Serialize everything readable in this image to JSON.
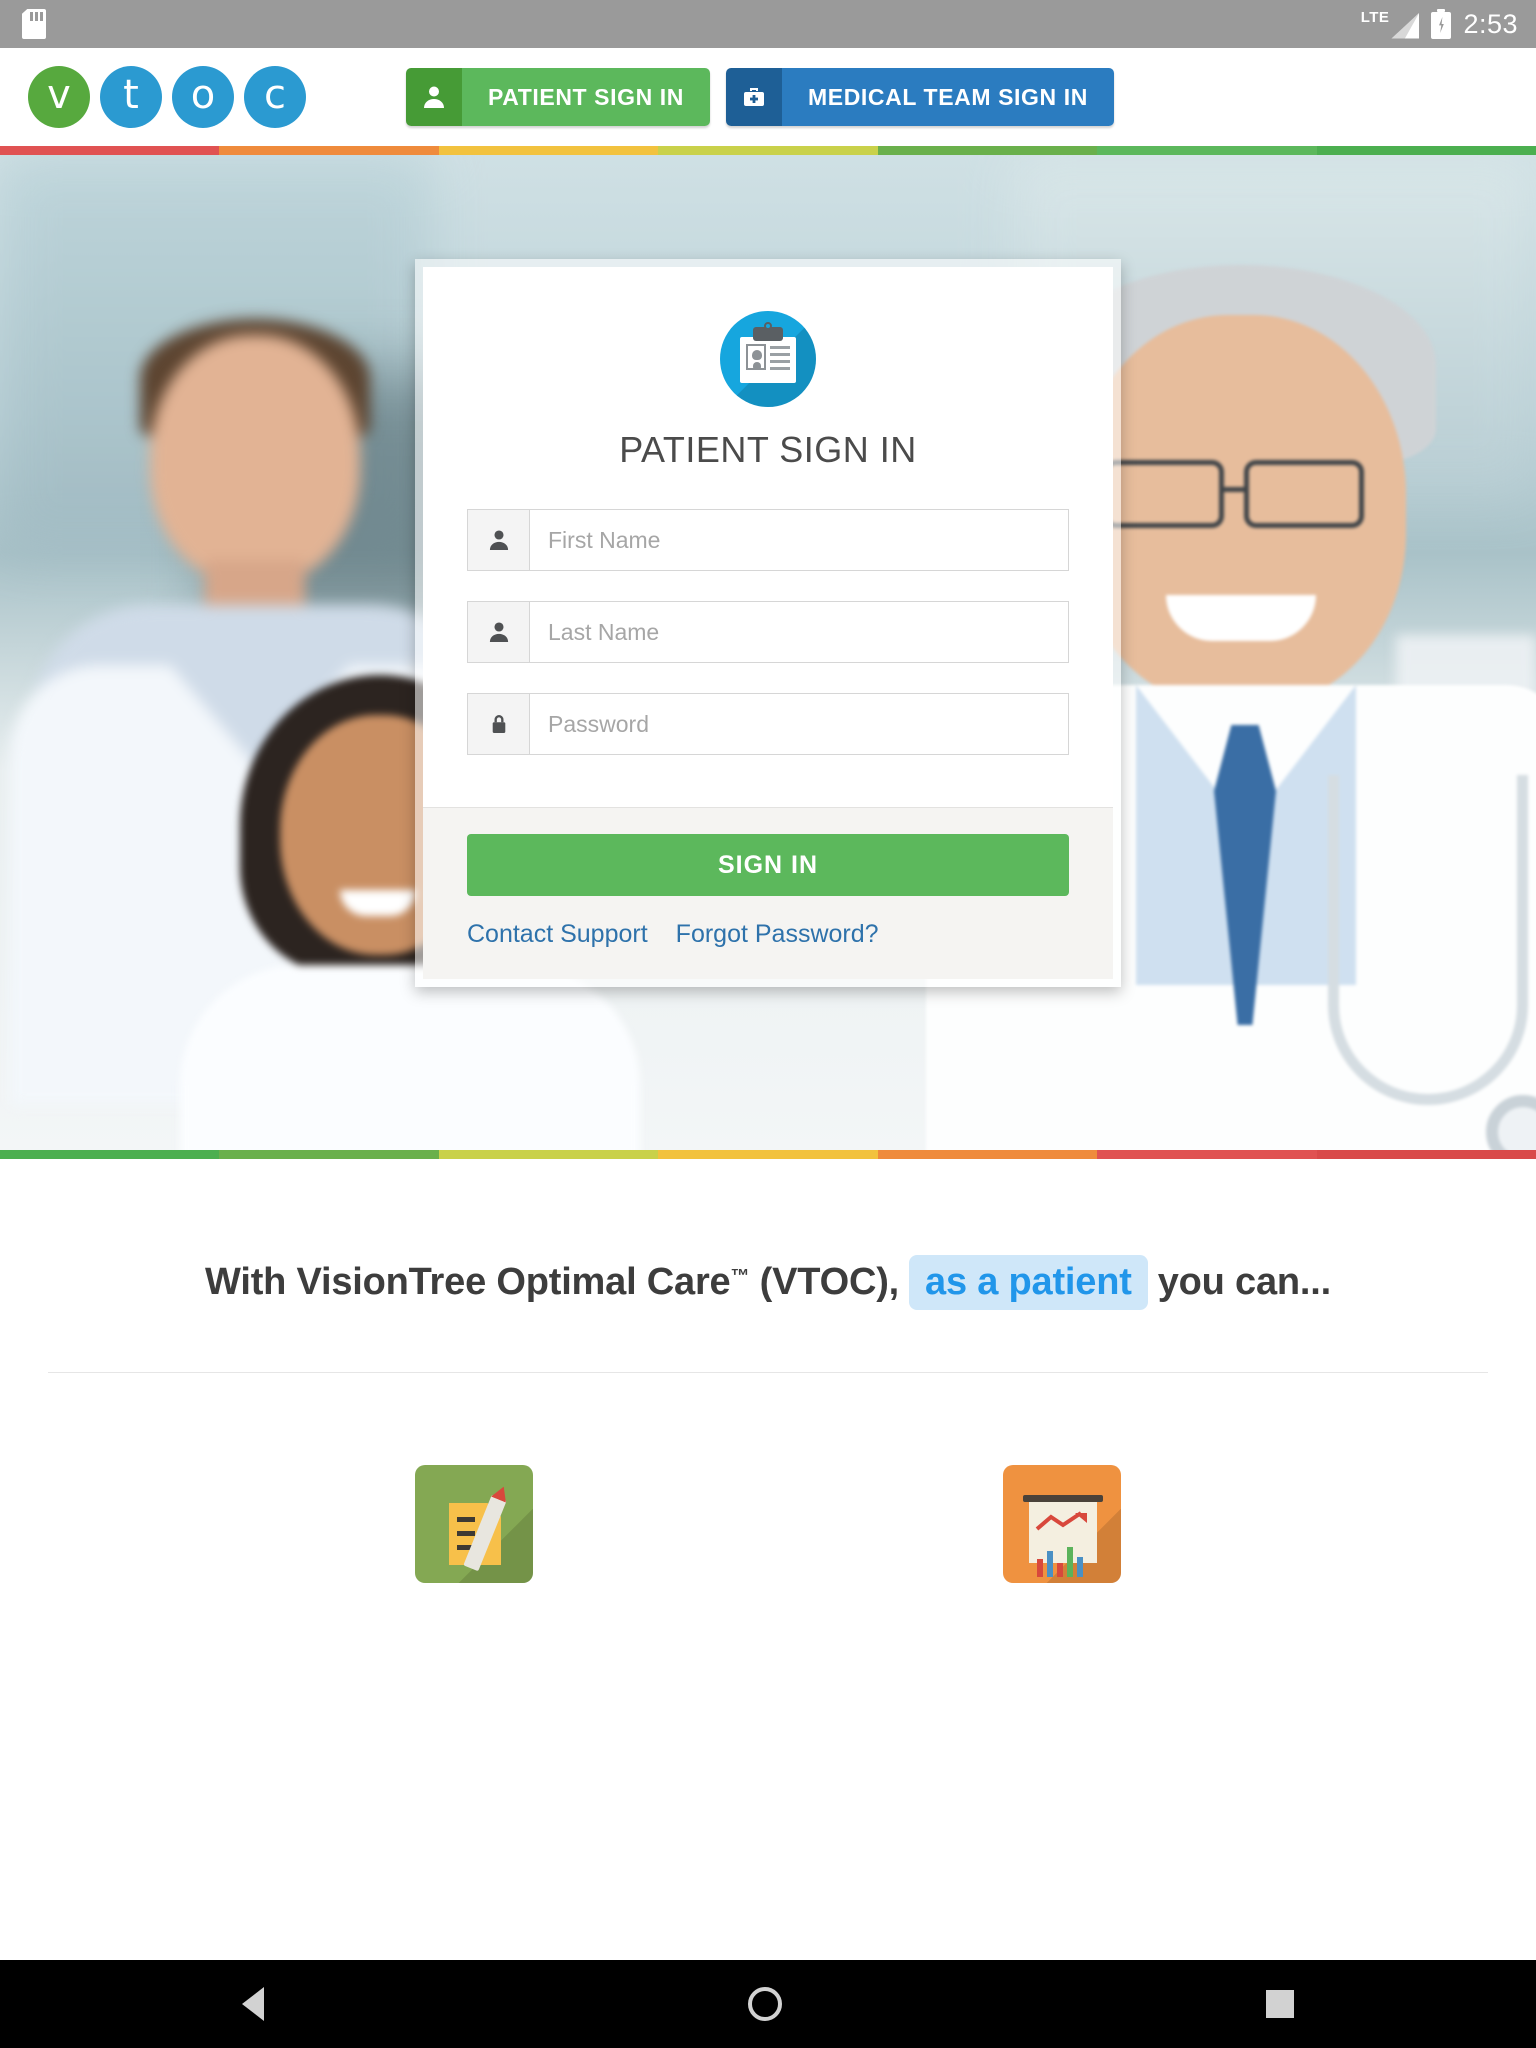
{
  "statusbar": {
    "sd_icon": "sd-card-icon",
    "network": "LTE",
    "battery_icon": "battery-charging-icon",
    "time": "2:53"
  },
  "header": {
    "logo": {
      "name": "vtoc-logo",
      "letters": [
        "v",
        "t",
        "o",
        "c"
      ],
      "colors": {
        "green": "#57a93e",
        "blue": "#2b9ad1"
      }
    },
    "buttons": [
      {
        "label": "PATIENT SIGN IN",
        "icon": "person-icon",
        "color": "#5cb85c"
      },
      {
        "label": "MEDICAL TEAM SIGN IN",
        "icon": "medical-bag-icon",
        "color": "#2b7cc0"
      }
    ]
  },
  "rainbow_top": [
    "#e05252",
    "#ef8b3c",
    "#f2c23e",
    "#c9d14a",
    "#6ab04c",
    "#5cb85c",
    "#4caf50"
  ],
  "rainbow_bottom": [
    "#4caf50",
    "#6ab04c",
    "#c9d14a",
    "#f2c23e",
    "#ef8b3c",
    "#e05252",
    "#d94a4a"
  ],
  "login_card": {
    "icon": "id-badge-clipboard-icon",
    "title": "PATIENT SIGN IN",
    "fields": [
      {
        "name": "first-name",
        "placeholder": "First Name",
        "value": "",
        "icon": "person-icon"
      },
      {
        "name": "last-name",
        "placeholder": "Last Name",
        "value": "",
        "icon": "person-icon"
      },
      {
        "name": "password",
        "placeholder": "Password",
        "value": "",
        "icon": "lock-icon"
      }
    ],
    "submit_label": "SIGN IN",
    "links": [
      {
        "label": "Contact Support"
      },
      {
        "label": "Forgot Password?"
      }
    ]
  },
  "promo": {
    "prefix": "With VisionTree Optimal Care",
    "tm": "™",
    "middle": "(VTOC),",
    "pill": "as a patient",
    "suffix": "you can...",
    "tiles": [
      {
        "name": "forms-tile",
        "icon": "form-pencil-icon",
        "color": "#84a853"
      },
      {
        "name": "reports-tile",
        "icon": "chart-presentation-icon",
        "color": "#ef9240"
      }
    ]
  },
  "navbar": {
    "back": "back-icon",
    "home": "home-icon",
    "recents": "recents-icon"
  }
}
